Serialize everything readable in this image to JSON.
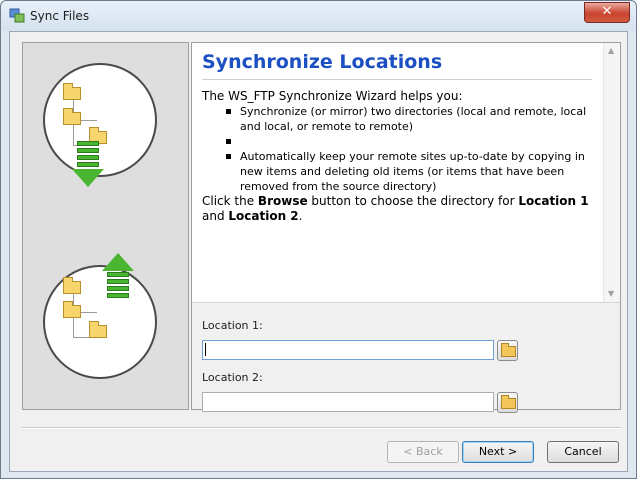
{
  "window": {
    "title": "Sync Files",
    "close_symbol": "✕"
  },
  "content": {
    "heading": "Synchronize Locations",
    "intro": "The WS_FTP Synchronize Wizard helps you:",
    "bullet1": "Synchronize (or mirror) two directories (local and remote, local and local, or remote to remote)",
    "bullet2": "Automatically keep your remote sites up-to-date by copying in new items and deleting old items (or items that have been removed from the source directory)",
    "instr_pre": "Click the ",
    "instr_browse": "Browse",
    "instr_mid": " button to choose the directory for ",
    "instr_loc1": "Location 1",
    "instr_and": " and ",
    "instr_loc2": "Location 2",
    "instr_end": "."
  },
  "form": {
    "location1_label": "Location 1:",
    "location1_value": "",
    "location2_label": "Location 2:",
    "location2_value": ""
  },
  "buttons": {
    "back": "< Back",
    "next": "Next >",
    "cancel": "Cancel"
  },
  "icons": {
    "app": "sync-files-app-icon",
    "browse": "folder-icon",
    "scroll_up": "▲",
    "scroll_down": "▼"
  },
  "colors": {
    "heading": "#1c4fc2",
    "arrow": "#49b531",
    "folder": "#f6d66c"
  }
}
